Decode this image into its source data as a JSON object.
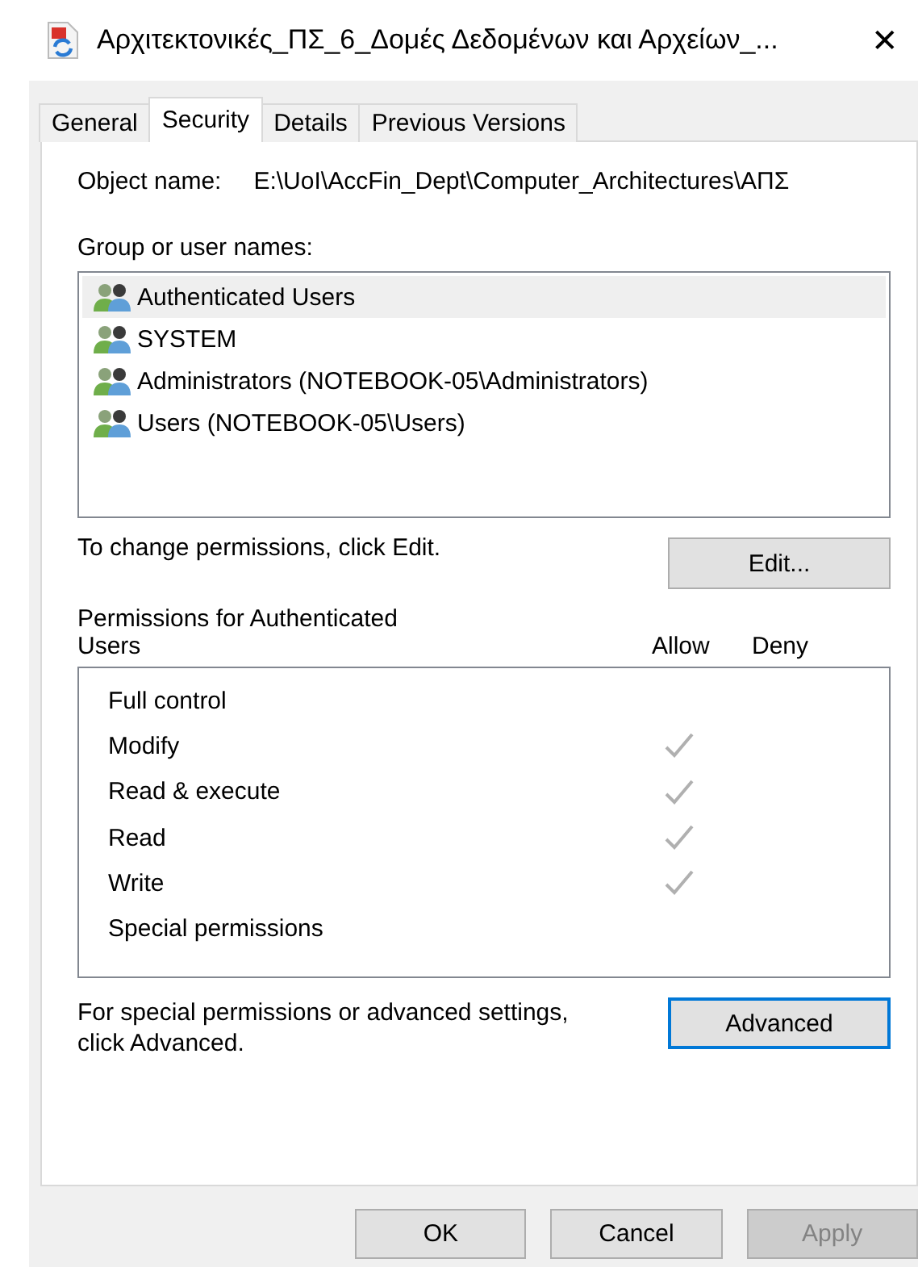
{
  "window": {
    "title": "Αρχιτεκτονικές_ΠΣ_6_Δομές Δεδομένων και Αρχείων_...",
    "close": "✕"
  },
  "tabs": [
    {
      "label": "General",
      "selected": false
    },
    {
      "label": "Security",
      "selected": true
    },
    {
      "label": "Details",
      "selected": false
    },
    {
      "label": "Previous Versions",
      "selected": false
    }
  ],
  "object_name": {
    "label": "Object name:",
    "value": "E:\\UoI\\AccFin_Dept\\Computer_Architectures\\ΑΠΣ"
  },
  "group_label": "Group or user names:",
  "users": [
    {
      "name": "Authenticated Users",
      "selected": true
    },
    {
      "name": "SYSTEM",
      "selected": false
    },
    {
      "name": "Administrators (NOTEBOOK-05\\Administrators)",
      "selected": false
    },
    {
      "name": "Users (NOTEBOOK-05\\Users)",
      "selected": false
    }
  ],
  "change_hint": "To change permissions, click Edit.",
  "edit_button": "Edit...",
  "permissions_label": "Permissions for Authenticated Users",
  "allow_header": "Allow",
  "deny_header": "Deny",
  "permissions": [
    {
      "name": "Full control",
      "allow": false,
      "deny": false
    },
    {
      "name": "Modify",
      "allow": true,
      "deny": false
    },
    {
      "name": "Read & execute",
      "allow": true,
      "deny": false
    },
    {
      "name": "Read",
      "allow": true,
      "deny": false
    },
    {
      "name": "Write",
      "allow": true,
      "deny": false
    },
    {
      "name": "Special permissions",
      "allow": false,
      "deny": false
    }
  ],
  "advanced_hint": "For special permissions or advanced settings, click Advanced.",
  "advanced_button": {
    "label": "Advanced",
    "focused": true
  },
  "buttons": [
    {
      "label": "OK",
      "disabled": false
    },
    {
      "label": "Cancel",
      "disabled": false
    },
    {
      "label": "Apply",
      "disabled": true
    }
  ]
}
